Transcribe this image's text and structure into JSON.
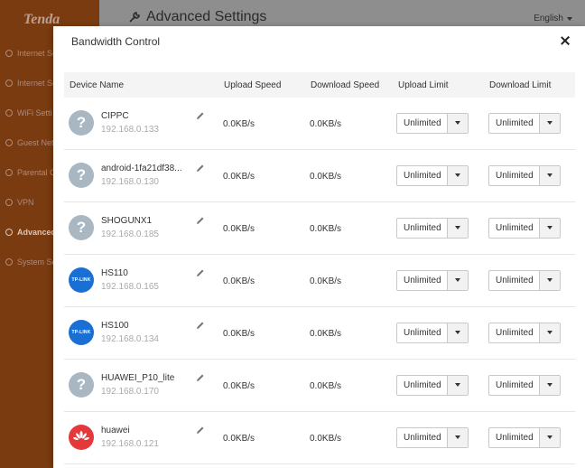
{
  "app": {
    "brand": "Tenda",
    "page_title": "Advanced Settings",
    "language": "English",
    "sidebar": [
      {
        "label": "Internet Se"
      },
      {
        "label": "Internet Se"
      },
      {
        "label": "WiFi Setti"
      },
      {
        "label": "Guest Net"
      },
      {
        "label": "Parental C"
      },
      {
        "label": "VPN"
      },
      {
        "label": "Advanced"
      },
      {
        "label": "System Se"
      }
    ]
  },
  "modal": {
    "title": "Bandwidth Control",
    "columns": {
      "device_name": "Device Name",
      "upload_speed": "Upload Speed",
      "download_speed": "Download Speed",
      "upload_limit": "Upload Limit",
      "download_limit": "Download Limit"
    },
    "devices": [
      {
        "name": "CIPPC",
        "ip": "192.168.0.133",
        "icon": "unknown-device-icon",
        "upload": "0.0KB/s",
        "download": "0.0KB/s",
        "upload_limit": "Unlimited",
        "download_limit": "Unlimited"
      },
      {
        "name": "android-1fa21df38...",
        "ip": "192.168.0.130",
        "icon": "unknown-device-icon",
        "upload": "0.0KB/s",
        "download": "0.0KB/s",
        "upload_limit": "Unlimited",
        "download_limit": "Unlimited"
      },
      {
        "name": "SHOGUNX1",
        "ip": "192.168.0.185",
        "icon": "unknown-device-icon",
        "upload": "0.0KB/s",
        "download": "0.0KB/s",
        "upload_limit": "Unlimited",
        "download_limit": "Unlimited"
      },
      {
        "name": "HS110",
        "ip": "192.168.0.165",
        "icon": "tp-link-icon",
        "logo_text": "TP-LINK",
        "upload": "0.0KB/s",
        "download": "0.0KB/s",
        "upload_limit": "Unlimited",
        "download_limit": "Unlimited"
      },
      {
        "name": "HS100",
        "ip": "192.168.0.134",
        "icon": "tp-link-icon",
        "logo_text": "TP-LINK",
        "upload": "0.0KB/s",
        "download": "0.0KB/s",
        "upload_limit": "Unlimited",
        "download_limit": "Unlimited"
      },
      {
        "name": "HUAWEI_P10_lite",
        "ip": "192.168.0.170",
        "icon": "unknown-device-icon",
        "upload": "0.0KB/s",
        "download": "0.0KB/s",
        "upload_limit": "Unlimited",
        "download_limit": "Unlimited"
      },
      {
        "name": "huawei",
        "ip": "192.168.0.121",
        "icon": "huawei-icon",
        "upload": "0.0KB/s",
        "download": "0.0KB/s",
        "upload_limit": "Unlimited",
        "download_limit": "Unlimited"
      }
    ]
  },
  "colors": {
    "sidebar_bg": "#7a3b10",
    "tp_link_blue": "#1a6fd4",
    "huawei_red": "#e5383b",
    "unknown_gray": "#a9b7c3"
  }
}
